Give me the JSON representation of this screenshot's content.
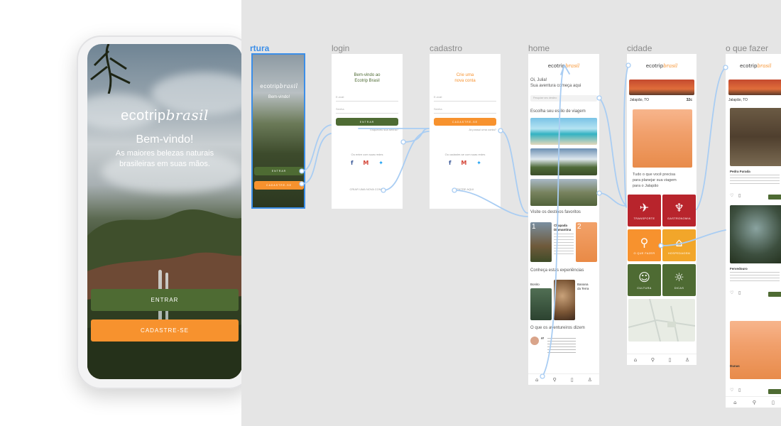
{
  "frames": [
    {
      "id": "abertura",
      "label": "rtura"
    },
    {
      "id": "login",
      "label": "login"
    },
    {
      "id": "cadastro",
      "label": "cadastro"
    },
    {
      "id": "home",
      "label": "home"
    },
    {
      "id": "cidade",
      "label": "cidade"
    },
    {
      "id": "oquefazer",
      "label": "o que fazer"
    }
  ],
  "brand": {
    "logo_main": "ecotrip",
    "logo_script": "brasil",
    "green": "#4e6b33",
    "orange": "#f7922e",
    "selection": "#3b8ee8"
  },
  "opening": {
    "welcome": "Bem-vindo!",
    "tagline_1": "As maiores belezas naturais",
    "tagline_2": "brasileiras em suas mãos.",
    "enter_button": "ENTRAR",
    "signup_button": "CADASTRE-SE"
  },
  "mini_opening": {
    "welcome": "Bem-vindo!",
    "enter": "ENTRAR",
    "signup": "CADASTRE-SE"
  },
  "login": {
    "title_1": "Bem-vindo ao",
    "title_2": "Ecotrip Brasil",
    "email": "E-mail",
    "password": "Senha",
    "button": "ENTRAR",
    "forgot": "Esqueceu sua senha?",
    "social": "Ou entre com suas redes",
    "create": "CRIAR UMA NOVA CONTA"
  },
  "signup": {
    "title_1": "Crie uma",
    "title_2": "nova conta",
    "email": "E-mail",
    "password": "Senha",
    "button": "CADASTRE-SE",
    "have_account": "Já possui uma conta?",
    "social": "Ou cadastre-se com suas redes",
    "enter": "ENTRE AQUI"
  },
  "home": {
    "greeting": "Oi, Julia!",
    "subtitle": "Sua aventura começa aqui",
    "search_placeholder": "Pesquise seu destino",
    "choose_style": "Escolha seu estilo de viagem",
    "favorites": "Visite os destinos favoritos",
    "fav_1_num": "1",
    "fav_1_title": "Chapada",
    "fav_1_sub": "Diamantina",
    "fav_2_num": "2",
    "experiences": "Conheça estas experiências",
    "exp_1": "Bonito",
    "exp_2_a": "Banana",
    "exp_2_b": "da Terra",
    "travelers": "O que os aventureiros dizem"
  },
  "city": {
    "location": "Jalapão, TO",
    "temp": "32c",
    "headline_1": "Tudo o que você precisa",
    "headline_2": "para planejar sua viagem",
    "headline_3": "para o Jalapão",
    "tiles": [
      {
        "icon": "✈",
        "label": "TRANSPORTE",
        "color": "#b8242c"
      },
      {
        "icon": "♆",
        "label": "GASTRONOMIA",
        "color": "#b8242c"
      },
      {
        "icon": "⚲",
        "label": "O QUE FAZER",
        "color": "#f7922e"
      },
      {
        "icon": "⌂",
        "label": "HOSPEDAGEM",
        "color": "#f2a62a"
      },
      {
        "icon": "☺",
        "label": "CULTURA",
        "color": "#4e6b33"
      },
      {
        "icon": "☼",
        "label": "DICAS",
        "color": "#4e6b33"
      }
    ]
  },
  "todo": {
    "location": "Jalapão, TO",
    "item_1": "Pedra Furada",
    "item_2": "Fervedouro",
    "item_3": "Dunas"
  }
}
